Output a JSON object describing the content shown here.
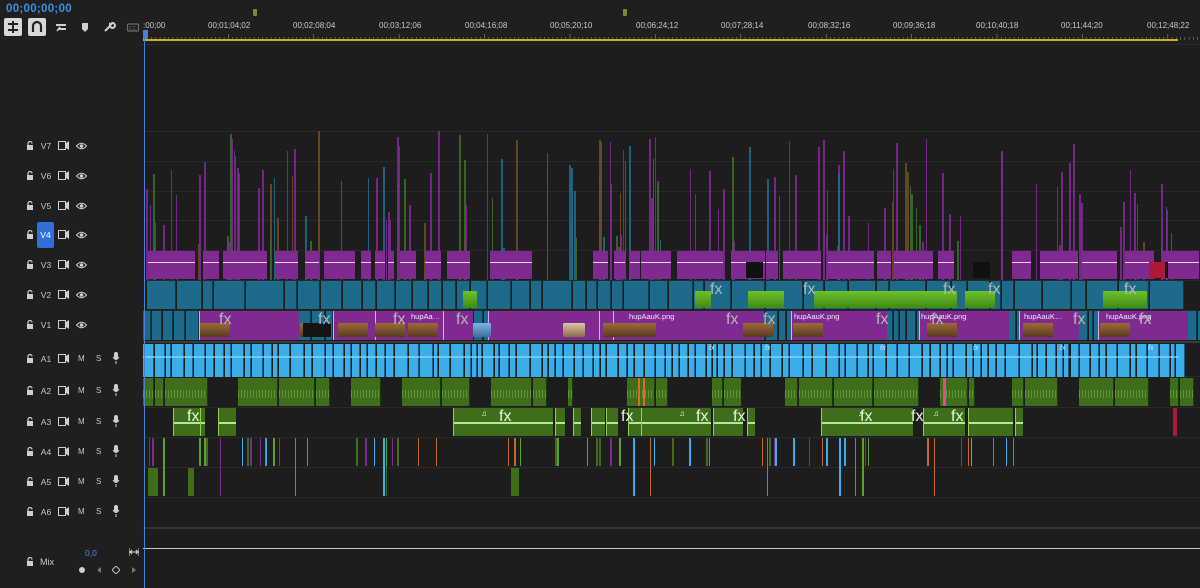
{
  "timecode": "00;00;00;00",
  "tools": [
    {
      "name": "insert-nest-icon",
      "active": true
    },
    {
      "name": "snap-icon",
      "active": true
    },
    {
      "name": "linked-selection-icon",
      "active": false
    },
    {
      "name": "add-marker-icon",
      "active": false
    },
    {
      "name": "settings-wrench-icon",
      "active": false
    },
    {
      "name": "captions-icon",
      "active": false
    }
  ],
  "ruler": {
    "labels": [
      ":00;00",
      "00;01;04;02",
      "00;02;08;04",
      "00;03;12;06",
      "00;04;16;08",
      "00;05;20;10",
      "00;06;24;12",
      "00;07;28;14",
      "00;08;32;16",
      "00;09;36;18",
      "00;10;40;18",
      "00;11;44;20",
      "00;12;48;22"
    ]
  },
  "video_tracks": [
    {
      "name": "V7",
      "target": false
    },
    {
      "name": "V6",
      "target": false
    },
    {
      "name": "V5",
      "target": false
    },
    {
      "name": "V4",
      "target": true
    },
    {
      "name": "V3",
      "target": false
    },
    {
      "name": "V2",
      "target": false
    },
    {
      "name": "V1",
      "target": false
    }
  ],
  "audio_tracks": [
    {
      "name": "A1",
      "mute": "M",
      "solo": "S"
    },
    {
      "name": "A2",
      "mute": "M",
      "solo": "S"
    },
    {
      "name": "A3",
      "mute": "M",
      "solo": "S"
    },
    {
      "name": "A4",
      "mute": "M",
      "solo": "S"
    },
    {
      "name": "A5",
      "mute": "M",
      "solo": "S"
    },
    {
      "name": "A6",
      "mute": "M",
      "solo": "S"
    }
  ],
  "mix": {
    "label": "Mix",
    "value": "0,0"
  },
  "clip_labels": {
    "fx": "fx",
    "hupA_short": "hupAa…",
    "hupA_png": "hupAauK.png",
    "hupA_k": "hupAauK…",
    "note": "♫"
  },
  "colors": {
    "magenta": "#7e2a91",
    "teal": "#1e6a8a",
    "lightblue": "#3aaee8",
    "green": "#3e6e1c",
    "accent": "#3d8fe8"
  }
}
